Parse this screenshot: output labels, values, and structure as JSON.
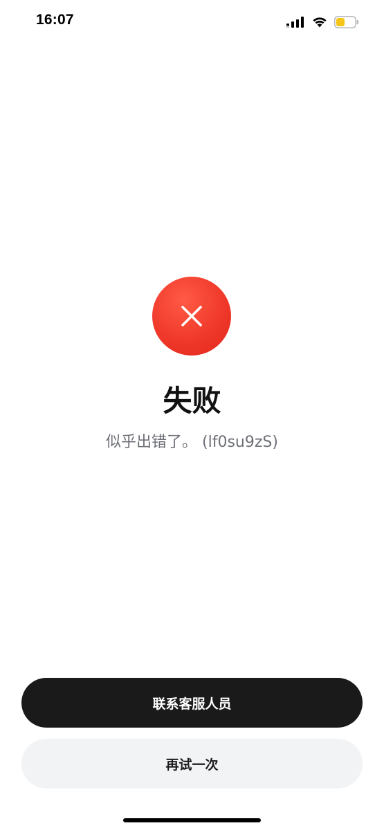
{
  "status_bar": {
    "time": "16:07",
    "icons": [
      "signal-icon",
      "wifi-icon",
      "battery-icon"
    ],
    "battery_color": "#f5c518"
  },
  "error": {
    "icon": "close-icon",
    "icon_color": "#f0392a",
    "title": "失败",
    "message": "似乎出错了。 (lf0su9zS)"
  },
  "actions": {
    "contact_support_label": "联系客服人员",
    "retry_label": "再试一次"
  }
}
